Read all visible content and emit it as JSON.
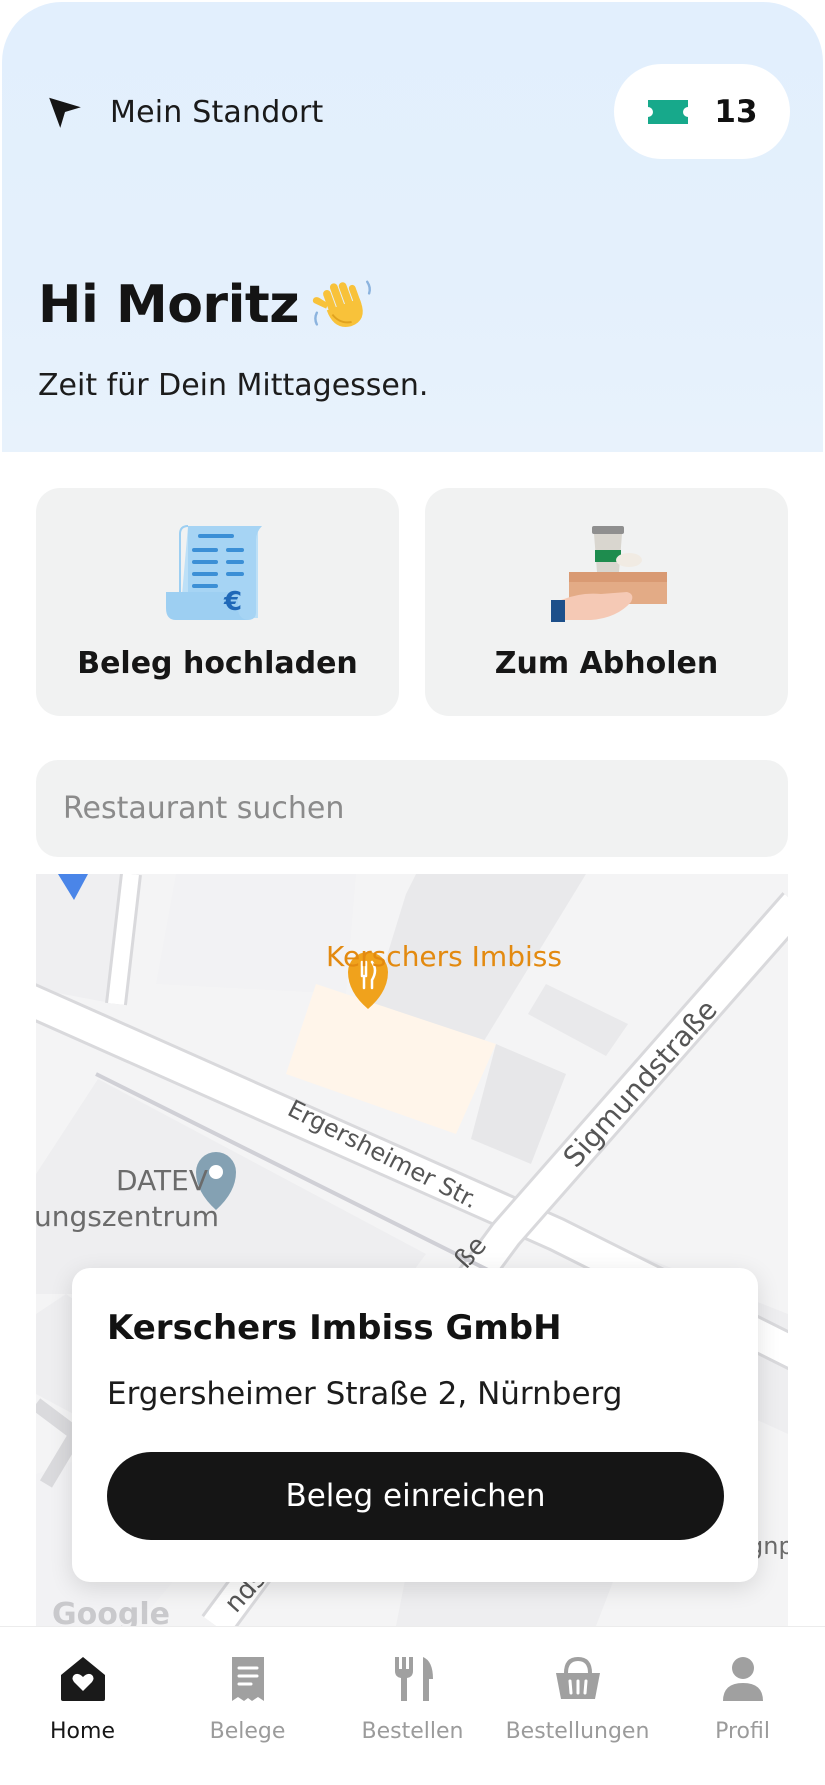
{
  "header": {
    "location_label": "Mein Standort",
    "voucher_count": "13",
    "greeting": "Hi Moritz",
    "greeting_emoji": "waving-hand",
    "subtitle": "Zeit für Dein Mittagessen."
  },
  "actions": [
    {
      "label": "Beleg hochladen",
      "icon": "receipt-euro-icon"
    },
    {
      "label": "Zum Abholen",
      "icon": "takeaway-hand-icon"
    }
  ],
  "search": {
    "placeholder": "Restaurant suchen"
  },
  "map": {
    "labels": {
      "restaurant": "Kerschers Imbiss",
      "street_1": "Ergersheimer Str.",
      "street_2": "Sigmundstraße",
      "poi_1": "DATEV",
      "poi_2": "ungszentrum",
      "fragment_1": "ße",
      "fragment_2": "nds",
      "fragment_3": "gnp",
      "logo": "Google"
    }
  },
  "popup": {
    "name": "Kerschers Imbiss GmbH",
    "address": "Ergersheimer Straße 2, Nürnberg",
    "button": "Beleg einreichen"
  },
  "tabs": [
    {
      "label": "Home",
      "icon": "home-heart-icon",
      "active": true
    },
    {
      "label": "Belege",
      "icon": "receipt-icon",
      "active": false
    },
    {
      "label": "Bestellen",
      "icon": "cutlery-icon",
      "active": false
    },
    {
      "label": "Bestellungen",
      "icon": "basket-icon",
      "active": false
    },
    {
      "label": "Profil",
      "icon": "profile-icon",
      "active": false
    }
  ],
  "colors": {
    "header_bg": "#e3effc",
    "accent_teal": "#17a98b",
    "restaurant_orange": "#e8950e",
    "button_dark": "#151515",
    "card_bg": "#f1f2f2",
    "inactive_tab": "#9b9b9b"
  }
}
